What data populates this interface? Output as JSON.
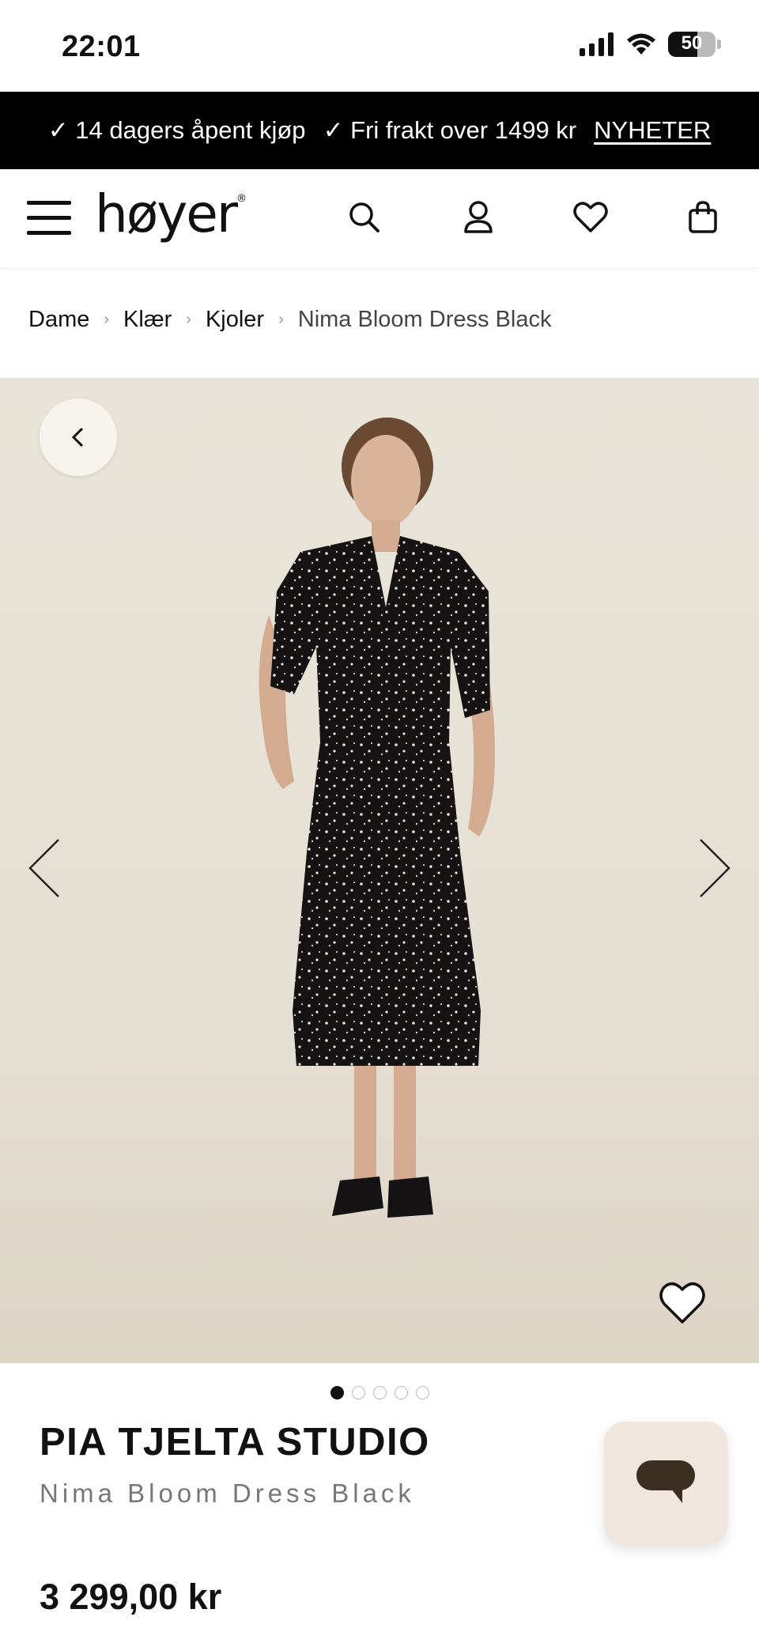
{
  "status_bar": {
    "time": "22:01",
    "battery": "50"
  },
  "promo": {
    "item1": "✓ 14 dagers åpent kjøp",
    "item2": "✓ Fri frakt over 1499 kr",
    "link": "NYHETER"
  },
  "header": {
    "logo": "høyer",
    "icons": [
      "menu-icon",
      "search-icon",
      "account-icon",
      "heart-icon",
      "bag-icon"
    ]
  },
  "breadcrumb": {
    "items": [
      "Dame",
      "Klær",
      "Kjoler"
    ],
    "current": "Nima Bloom Dress Black",
    "separator": "›"
  },
  "gallery": {
    "image_count": 5,
    "active_index": 1
  },
  "product": {
    "brand": "PIA TJELTA STUDIO",
    "name": "Nima Bloom Dress Black",
    "price": "3 299,00 kr"
  },
  "colors": {
    "promo_bg": "#000000",
    "accent": "#111111",
    "chat_bg": "#efe7dd",
    "chat_icon": "#3d2e22"
  }
}
